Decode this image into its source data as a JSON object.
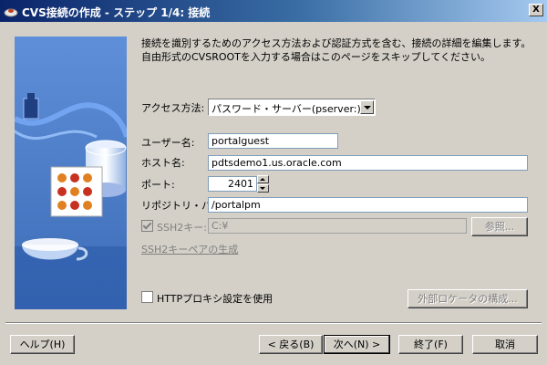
{
  "window": {
    "title": "CVS接続の作成 - ステップ 1/4: 接続",
    "close_label": "X"
  },
  "description": "接続を識別するためのアクセス方法および認証方式を含む、接続の詳細を編集します。自由形式のCVSROOTを入力する場合はこのページをスキップしてください。",
  "form": {
    "access_method": {
      "label": "アクセス方法:",
      "value": "パスワード・サーバー(pserver:)"
    },
    "username": {
      "label": "ユーザー名:",
      "value": "portalguest"
    },
    "hostname": {
      "label": "ホスト名:",
      "value": "pdtsdemo1.us.oracle.com"
    },
    "port": {
      "label": "ポート:",
      "value": "2401"
    },
    "repository_path": {
      "label": "リポジトリ・パス:",
      "value": "/portalpm"
    },
    "ssh2_key": {
      "label": "SSH2キー:",
      "value": "C:¥",
      "browse_label": "参照..."
    },
    "ssh2_generate_link": "SSH2キーペアの生成",
    "http_proxy": {
      "label": "HTTPプロキシ設定を使用"
    },
    "external_locator_label": "外部ロケータの構成..."
  },
  "buttons": {
    "help": "ヘルプ(H)",
    "back": "< 戻る(B)",
    "next": "次へ(N) >",
    "finish": "終了(F)",
    "cancel": "取消"
  },
  "colors": {
    "titlebar_start": "#0a246a",
    "titlebar_end": "#a6caf0",
    "side_panel": "#4f7cc6"
  }
}
